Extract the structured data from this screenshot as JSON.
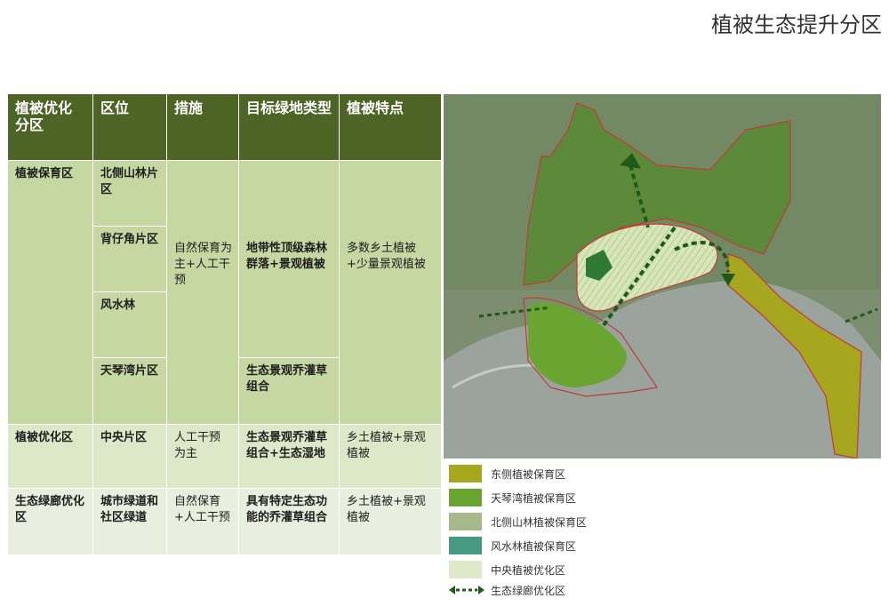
{
  "title": "植被生态提升分区",
  "table": {
    "headers": [
      "植被优化分区",
      "区位",
      "措施",
      "目标绿地类型",
      "植被特点"
    ],
    "protection": {
      "zone": "植被保育区",
      "locations": [
        "北侧山林片区",
        "背仔角片区",
        "风水林",
        "天琴湾片区"
      ],
      "measure": "自然保育为主+人工干预",
      "type_a": "地带性顶级森林群落+景观植被",
      "type_b": "生态景观乔灌草组合",
      "feature": "多数乡土植被+少量景观植被"
    },
    "optimize": {
      "zone": "植被优化区",
      "location": "中央片区",
      "measure": "人工干预为主",
      "type": "生态景观乔灌草组合+生态湿地",
      "feature": "乡土植被+景观植被"
    },
    "corridor": {
      "zone": "生态绿廊优化区",
      "location": "城市绿道和社区绿道",
      "measure": "自然保育+人工干预",
      "type": "具有特定生态功能的乔灌草组合",
      "feature": "乡土植被+景观植被"
    },
    "colors": {
      "header": "#4e6326",
      "protection": "#c6d8a2",
      "optimize": "#dde8c8",
      "corridor": "#e9efde"
    }
  },
  "legend": [
    {
      "label": "东侧植被保育区",
      "color": "#a7a71f"
    },
    {
      "label": "天琴湾植被保育区",
      "color": "#6aa531"
    },
    {
      "label": "北侧山林植被保育区",
      "color": "#a7b98a"
    },
    {
      "label": "风水林植被保育区",
      "color": "#479a80"
    },
    {
      "label": "中央植被优化区",
      "color": "#dfe8c8"
    },
    {
      "label": "生态绿廊优化区",
      "color": "#1f5a1a",
      "icon": "dashed-double-arrow-icon"
    }
  ]
}
